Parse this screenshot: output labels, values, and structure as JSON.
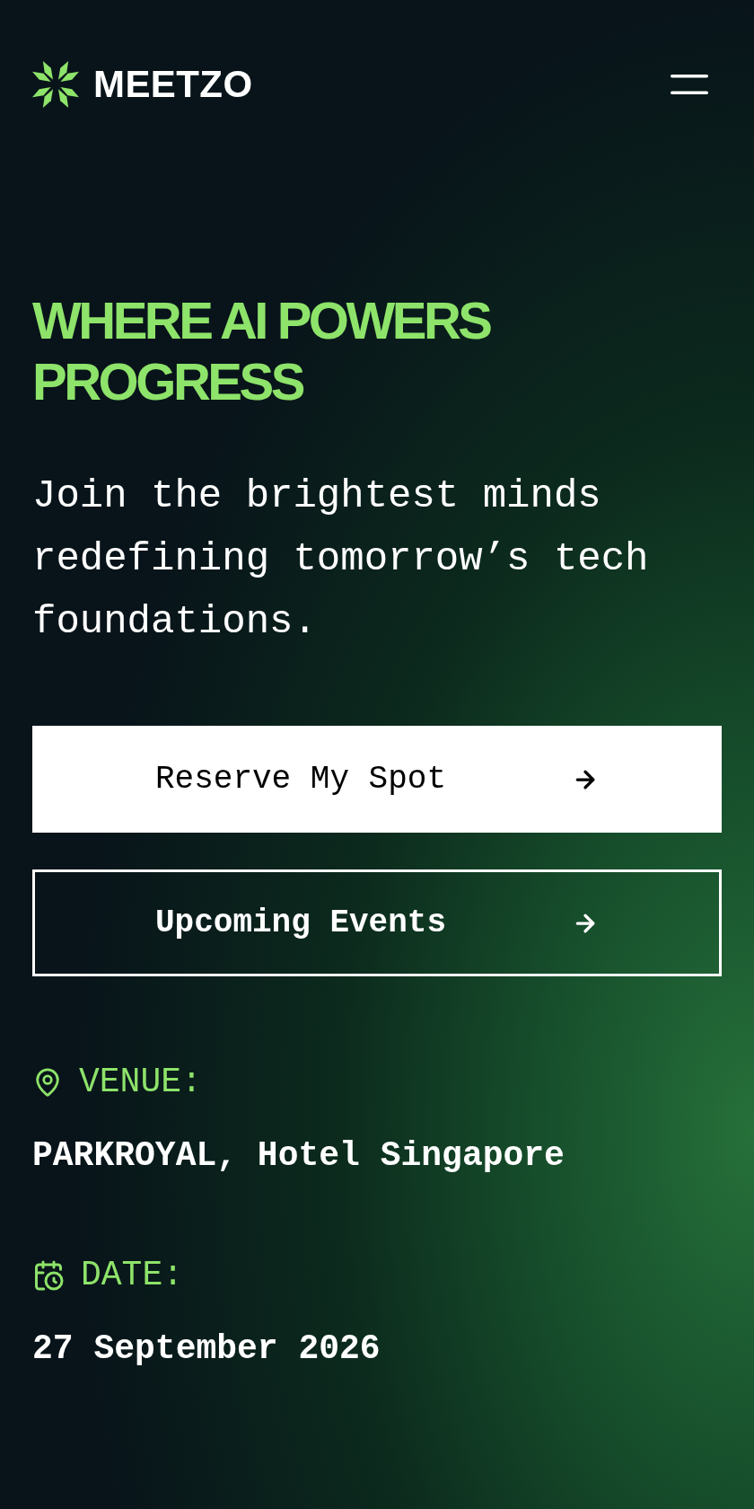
{
  "header": {
    "logo_text": "MEETZO"
  },
  "hero": {
    "title": "WHERE AI POWERS PROGRESS",
    "subtitle": "Join the brightest minds redefining tomorrow’s tech foundations."
  },
  "buttons": [
    {
      "label": "Reserve My Spot",
      "kind": "solid"
    },
    {
      "label": "Upcoming Events",
      "kind": "outline"
    }
  ],
  "details": [
    {
      "kind": "venue",
      "label": "VENUE:",
      "value": "PARKROYAL, Hotel Singapore"
    },
    {
      "kind": "date",
      "label": "DATE:",
      "value": "27 September 2026"
    }
  ]
}
